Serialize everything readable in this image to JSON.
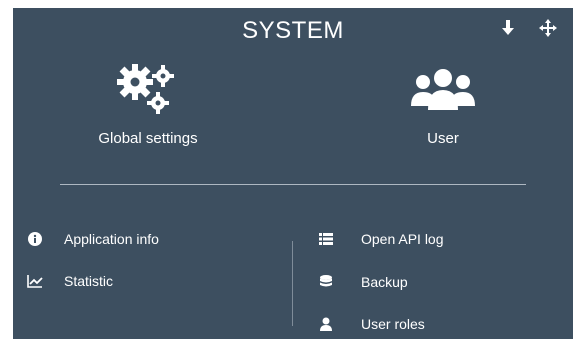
{
  "panel": {
    "title": "SYSTEM",
    "header_icons": [
      "arrow-down-icon",
      "move-icon"
    ]
  },
  "tiles": [
    {
      "label": "Global settings",
      "icon": "gears-icon"
    },
    {
      "label": "User",
      "icon": "users-icon"
    }
  ],
  "links_left": [
    {
      "label": "Application info",
      "icon": "info-icon"
    },
    {
      "label": "Statistic",
      "icon": "line-chart-icon"
    }
  ],
  "links_right": [
    {
      "label": "Open API log",
      "icon": "list-icon"
    },
    {
      "label": "Backup",
      "icon": "database-icon"
    },
    {
      "label": "User roles",
      "icon": "user-lock-icon"
    }
  ],
  "colors": {
    "panel_bg": "#3d4f60",
    "text": "#ffffff",
    "divider": "#aeb8c2"
  }
}
